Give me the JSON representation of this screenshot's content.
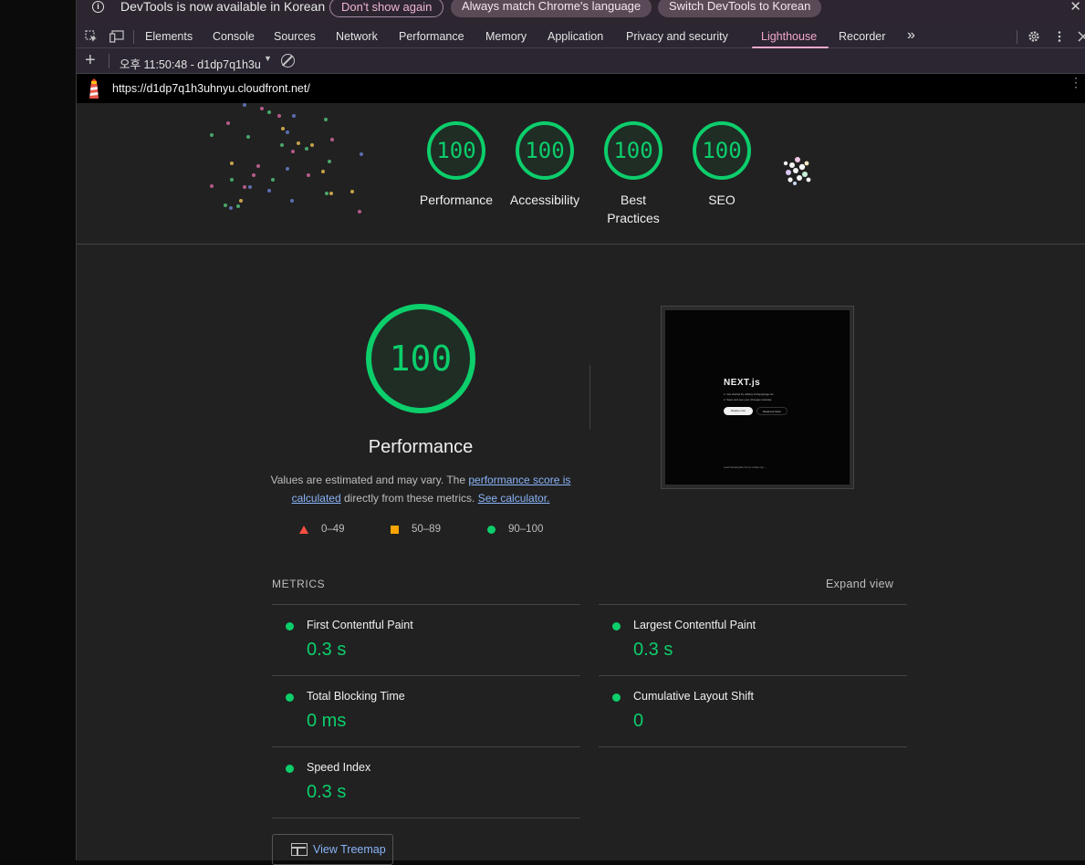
{
  "infobar": {
    "message": "DevTools is now available in Korean",
    "dont_show": "Don't show again",
    "always_match": "Always match Chrome's language",
    "switch": "Switch DevTools to Korean",
    "close": "✕"
  },
  "tabs": [
    "Elements",
    "Console",
    "Sources",
    "Network",
    "Performance",
    "Memory",
    "Application",
    "Privacy and security",
    "Lighthouse",
    "Recorder"
  ],
  "active_tab": "Lighthouse",
  "overflow": "»",
  "lh_toolbar": {
    "plus": "+",
    "report_selector": "오후 11:50:48 - d1dp7q1h3u"
  },
  "url": "https://d1dp7q1h3uhnyu.cloudfront.net/",
  "categories": [
    {
      "label": "Performance",
      "score": "100"
    },
    {
      "label": "Accessibility",
      "score": "100"
    },
    {
      "label": "Best Practices",
      "score": "100"
    },
    {
      "label": "SEO",
      "score": "100"
    }
  ],
  "main": {
    "score": "100",
    "title": "Performance",
    "desc_pre": "Values are estimated and may vary. The ",
    "desc_link1": "performance score is calculated",
    "desc_mid": " directly from these metrics. ",
    "desc_link2": "See calculator."
  },
  "legend": {
    "fail": "0–49",
    "average": "50–89",
    "pass": "90–100"
  },
  "screenshot": {
    "logo": "NEXT.js",
    "line1": "1. Get started by editing src/app/page.tsx",
    "line2": "2. Save and see your changes instantly.",
    "deploy": "Deploy now",
    "docs": "Read our docs",
    "footer": "Learn   Examples   Go to nextjs.org →"
  },
  "metrics": {
    "header": "METRICS",
    "expand": "Expand view",
    "fcp": {
      "name": "First Contentful Paint",
      "value": "0.3 s"
    },
    "lcp": {
      "name": "Largest Contentful Paint",
      "value": "0.3 s"
    },
    "tbt": {
      "name": "Total Blocking Time",
      "value": "0 ms"
    },
    "cls": {
      "name": "Cumulative Layout Shift",
      "value": "0"
    },
    "si": {
      "name": "Speed Index",
      "value": "0.3 s"
    }
  },
  "treemap": "View Treemap",
  "colors": {
    "pass": "#0cce6b",
    "average": "#ffa400",
    "fail": "#ff4e42",
    "accent": "#f4a8cc",
    "link": "#8ab4f8"
  }
}
